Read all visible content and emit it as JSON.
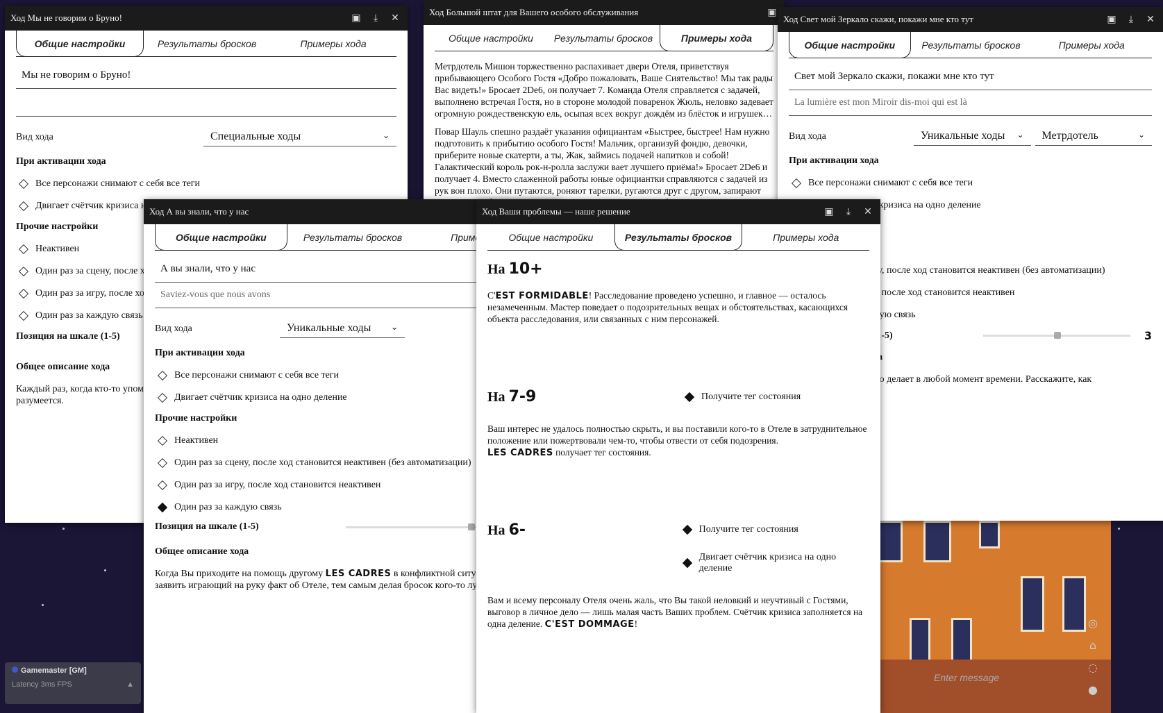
{
  "background": {
    "accent": "#1b1636",
    "chat_placeholder": "Enter message",
    "user_name": "Gamemaster [GM]",
    "latency": "Latency",
    "fps": "3ms FPS"
  },
  "tabs_common": {
    "general": "Общие настройки",
    "results": "Результаты бросков",
    "examples": "Примеры хода"
  },
  "labels": {
    "move_type": "Вид хода",
    "on_activation": "При активации хода",
    "other_settings": "Прочие настройки",
    "scale_position": "Позиция на шкале (1-5)",
    "description_title": "Общее описание хода",
    "all_remove_tags": "Все персонажи снимают с себя все теги",
    "crisis_counter": "Двигает счётчик кризиса на одно деление",
    "inactive": "Неактивен",
    "once_scene": "Один раз за сцену, после ход становится неактивен (без автоматизации)",
    "once_game": "Один раз за игру, после ход становится неактивен",
    "once_link": "Один раз за каждую связь"
  },
  "win1": {
    "title": "Ход Мы не говорим о Бруно!",
    "name_value": "Мы не говорим о Бруно!",
    "move_type_value": "Специальные ходы",
    "desc": "Каждый раз, когда кто-то упоминает Бруно... Иначе он явится. Когда терять нечего — разумеется."
  },
  "win2": {
    "title": "Ход Большой штат для Вашего особого обслуживания",
    "p1": "Метрдотель Мишон торжественно распахивает двери Отеля, приветствуя прибывающего Особого Гостя «Добро пожаловать, Ваше Сиятельство! Мы так рады Вас видеть!» Бросает 2Dе6, он получает 7. Команда Отеля справляется с задачей, выполнено встречая Гостя, но в стороне молодой поваренок Жюль, неловко задевает огромную рождественскую ель, осыпая всех вокруг дождём из блёсток и игрушек…",
    "p2": "Повар Шауль спешно раздаёт указания официантам «Быстрее, быстрее! Нам нужно подготовить к прибытию особого Гостя! Мальчик, организуй фондю, девочки, приберите новые скатерти, а ты, Жак, займись подачей напитков и собой! Галактический король рок-н-ролла заслужи вает лучшего приёма!» Бросает 2Dе6 и получает 4. Вместо слаженной работы юные официантки справляются с задачей из рук вон плохо. Они путаются, роняют тарелки, ругаются друг с другом, запирают Жака в подсобке, а в конце и вовсе с визгом повисают... обслуживание... посетите..."
  },
  "win3": {
    "title": "Ход Свет мой Зеркало скажи, покажи мне кто тут",
    "name_value": "Свет мой Зеркало скажи, покажи мне кто тут",
    "name_fr": "La lumière est mon Miroir dis-moi qui est là",
    "move_type_value": "Уникальные ходы",
    "role_value": "Метрдотель",
    "scale_value": "3",
    "desc": "...о где находится и что делает в любой момент времени. Расскажите, как"
  },
  "win4": {
    "title": "Ход А вы знали, что у нас",
    "name_value": "А вы знали, что у нас",
    "name_fr": "Saviez-vous que nous avons",
    "move_type_value": "Уникальные ходы",
    "desc_a": "Когда Вы приходите на помощь другому ",
    "desc_caps": "LES CADRES",
    "desc_b": " в конфликтной ситуации, можете заявить играющий на руку факт об Отеле, тем самым делая бросок кого-то лучше."
  },
  "win5": {
    "title": "Ход Ваши проблемы — наше решение",
    "r1_head": "На ",
    "r1_num": "10+",
    "r1_caps": "EST FORMIDABLE",
    "r1_pre": "C'",
    "r1_text": "! Расследование проведено успешно, и главное — осталось незамеченным. Мастер поведает о подозрительных вещах и обстоятельствах, касающихся объекта расследования, или связанных с ним персонажей.",
    "r2_num": "7-9",
    "r2_effect": "Получите тег состояния",
    "r2_text": "Ваш интерес не удалось полностью скрыть, и вы поставили кого-то в Отеле в затруднительное положение или пожертвовали чем-то, чтобы отвести от себя подозрения.",
    "r2_caps": "LES CADRES",
    "r2_tail": " получает тег состояния.",
    "r3_num": "6-",
    "r3_effect1": "Получите тег состояния",
    "r3_effect2": "Двигает счётчик кризиса на одно деление",
    "r3_text": "Вам и всему персоналу Отеля очень жаль, что Вы такой неловкий и неучтивый с Гостями, выговор в личное дело — лишь малая часть Ваших проблем. Счётчик кризиса заполняется на одна деление. ",
    "r3_caps": "C'EST DOMMAGE",
    "r3_end": "!"
  }
}
